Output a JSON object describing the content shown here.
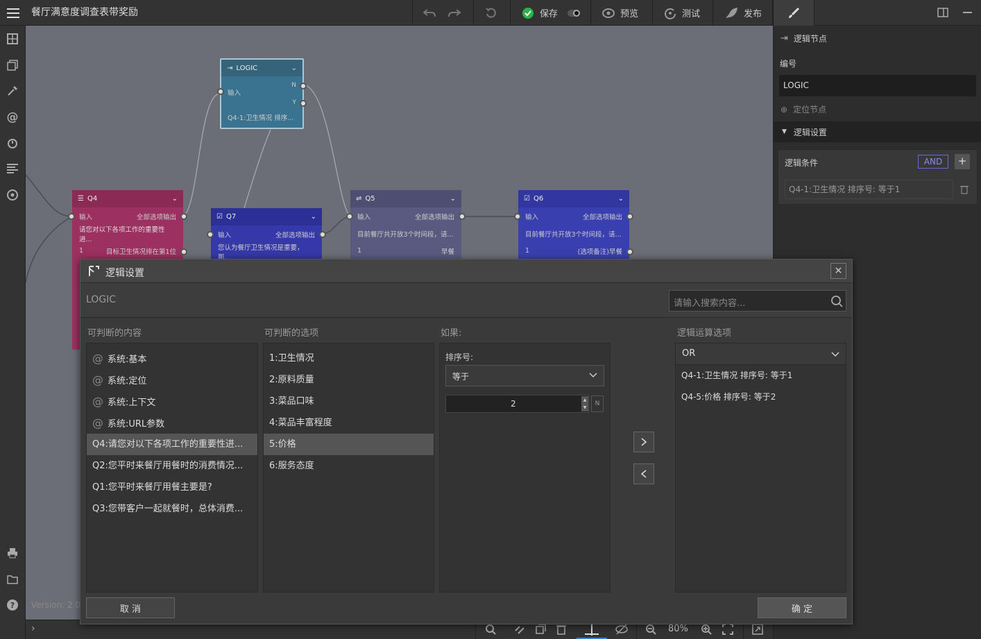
{
  "app": {
    "title": "餐厅满意度调查表带奖励"
  },
  "toolbar": {
    "save_label": "保存",
    "preview_label": "预览",
    "test_label": "测试",
    "publish_label": "发布"
  },
  "canvas": {
    "version_text": "Version: 2.0",
    "zoom": "80%",
    "logic_node": {
      "title": "LOGIC",
      "input": "输入",
      "port_n": "N",
      "port_y": "Y",
      "summary": "Q4-1:卫生情况 排序..."
    },
    "nodes": [
      {
        "id": "Q4",
        "input": "输入",
        "output": "全部选项输出",
        "desc": "请您对以下各项工作的重要性进...",
        "row_num": "1",
        "row_text": "目标卫生情况排在第1位"
      },
      {
        "id": "Q7",
        "input": "输入",
        "output": "全部选项输出",
        "desc": "您认为餐厅卫生情况是重要，那..."
      },
      {
        "id": "Q5",
        "input": "输入",
        "output": "全部选项输出",
        "desc": "目前餐厅共开放3个时间段，请...",
        "row_num": "1",
        "row_text": "早餐"
      },
      {
        "id": "Q6",
        "input": "输入",
        "output": "全部选项输出",
        "desc": "目前餐厅共开放3个时间段，请...",
        "row_num": "1",
        "row_text": "(选项备注)早餐"
      }
    ]
  },
  "right_panel": {
    "section_title": "逻辑节点",
    "id_label": "编号",
    "id_value": "LOGIC",
    "locate_label": "定位节点",
    "logic_settings_label": "逻辑设置",
    "conditions_label": "逻辑条件",
    "and_badge": "AND",
    "add_symbol": "+",
    "condition_item": "Q4-1:卫生情况 排序号: 等于1"
  },
  "dialog": {
    "title": "逻辑设置",
    "close_symbol": "×",
    "node_name": "LOGIC",
    "search_placeholder": "请输入搜索内容...",
    "col1_header": "可判断的内容",
    "col2_header": "可判断的选项",
    "col3_header": "如果:",
    "col4_header": "逻辑运算选项",
    "contents": [
      {
        "text": "系统:基本",
        "at": "@"
      },
      {
        "text": "系统:定位",
        "at": "@"
      },
      {
        "text": "系统:上下文",
        "at": "@"
      },
      {
        "text": "系统:URL参数",
        "at": "@"
      },
      {
        "text": "Q4:请您对以下各项工作的重要性进...",
        "at": ""
      },
      {
        "text": "Q2:您平时来餐厅用餐时的消费情况...",
        "at": ""
      },
      {
        "text": "Q1:您平时来餐厅用餐主要是?",
        "at": ""
      },
      {
        "text": "Q3:您带客户一起就餐时，总体消费...",
        "at": ""
      }
    ],
    "options": [
      "1:卫生情况",
      "2:原料质量",
      "3:菜品口味",
      "4:菜品丰富程度",
      "5:价格",
      "6:服务态度"
    ],
    "if_sort_label": "排序号:",
    "if_operator": "等于",
    "if_value": "2",
    "if_n_label": "N",
    "logic_op": "OR",
    "logic_items": [
      "Q4-1:卫生情况 排序号: 等于1",
      "Q4-5:价格 排序号: 等于2"
    ],
    "cancel_label": "取 消",
    "ok_label": "确 定"
  }
}
